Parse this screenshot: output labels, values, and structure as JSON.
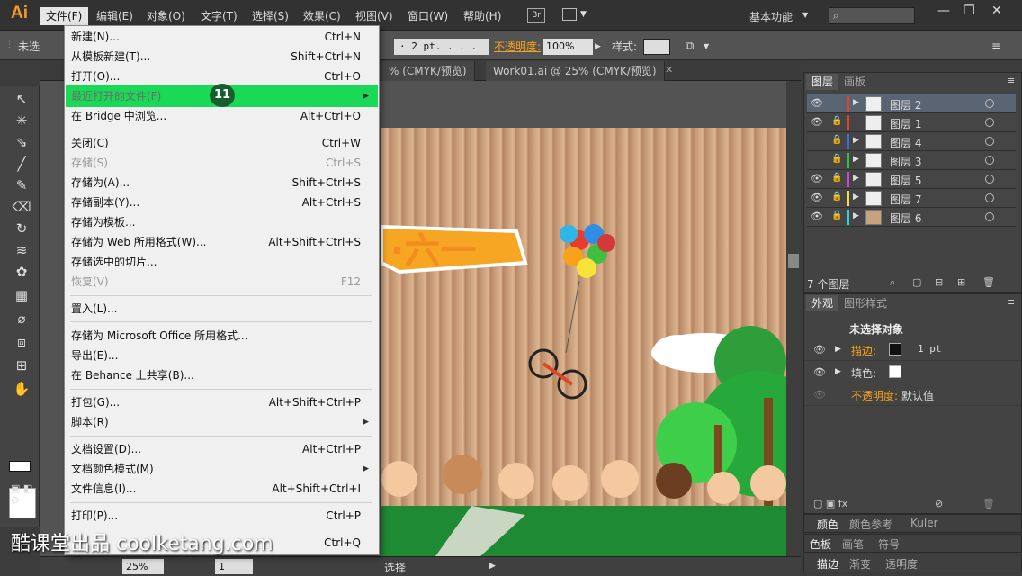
{
  "app": {
    "logo": "Ai",
    "workspace": "基本功能",
    "bridge_badge": "Br"
  },
  "menubar": {
    "items": [
      "文件(F)",
      "编辑(E)",
      "对象(O)",
      "文字(T)",
      "选择(S)",
      "效果(C)",
      "视图(V)",
      "窗口(W)",
      "帮助(H)"
    ],
    "active_index": 0
  },
  "controlbar": {
    "no_selection": "未选",
    "stroke_value": "· 2 pt. . . .",
    "opacity_label": "不透明度:",
    "opacity_value": "100%",
    "style_label": "样式:"
  },
  "tabs": [
    {
      "label": "% (CMYK/预览)",
      "active": false
    },
    {
      "label": "Work01.ai @ 25% (CMYK/预览)",
      "active": false
    }
  ],
  "file_menu": {
    "items": [
      {
        "label": "新建(N)...",
        "shortcut": "Ctrl+N",
        "disabled": false
      },
      {
        "label": "从模板新建(T)...",
        "shortcut": "Shift+Ctrl+N",
        "disabled": false
      },
      {
        "label": "打开(O)...",
        "shortcut": "Ctrl+O",
        "disabled": false
      },
      {
        "label": "最近打开的文件(F)",
        "shortcut": "",
        "disabled": false,
        "submenu": true,
        "highlight": true
      },
      {
        "label": "在 Bridge 中浏览...",
        "shortcut": "Alt+Ctrl+O",
        "disabled": false
      },
      {
        "label": "关闭(C)",
        "shortcut": "Ctrl+W",
        "disabled": false
      },
      {
        "label": "存储(S)",
        "shortcut": "Ctrl+S",
        "disabled": true
      },
      {
        "label": "存储为(A)...",
        "shortcut": "Shift+Ctrl+S",
        "disabled": false
      },
      {
        "label": "存储副本(Y)...",
        "shortcut": "Alt+Ctrl+S",
        "disabled": false
      },
      {
        "label": "存储为模板...",
        "shortcut": "",
        "disabled": false
      },
      {
        "label": "存储为 Web 所用格式(W)...",
        "shortcut": "Alt+Shift+Ctrl+S",
        "disabled": false
      },
      {
        "label": "存储选中的切片...",
        "shortcut": "",
        "disabled": false
      },
      {
        "label": "恢复(V)",
        "shortcut": "F12",
        "disabled": true
      },
      {
        "label": "置入(L)...",
        "shortcut": "",
        "disabled": false
      },
      {
        "label": "存储为 Microsoft Office 所用格式...",
        "shortcut": "",
        "disabled": false
      },
      {
        "label": "导出(E)...",
        "shortcut": "",
        "disabled": false
      },
      {
        "label": "在 Behance 上共享(B)...",
        "shortcut": "",
        "disabled": false
      },
      {
        "label": "打包(G)...",
        "shortcut": "Alt+Shift+Ctrl+P",
        "disabled": false
      },
      {
        "label": "脚本(R)",
        "shortcut": "",
        "disabled": false,
        "submenu": true
      },
      {
        "label": "文档设置(D)...",
        "shortcut": "Alt+Ctrl+P",
        "disabled": false
      },
      {
        "label": "文档颜色模式(M)",
        "shortcut": "",
        "disabled": false,
        "submenu": true
      },
      {
        "label": "文件信息(I)...",
        "shortcut": "Alt+Shift+Ctrl+I",
        "disabled": false
      },
      {
        "label": "打印(P)...",
        "shortcut": "Ctrl+P",
        "disabled": false
      },
      {
        "label": "",
        "shortcut": "Ctrl+Q",
        "disabled": false
      }
    ],
    "step_badge": "11"
  },
  "layers_panel": {
    "tabs": [
      "图层",
      "画板"
    ],
    "layers": [
      {
        "name": "图层 2",
        "visible": true,
        "locked": false,
        "color": "#e0452a",
        "selected": true
      },
      {
        "name": "图层 1",
        "visible": true,
        "locked": true,
        "color": "#e0452a",
        "selected": false
      },
      {
        "name": "图层 4",
        "visible": false,
        "locked": true,
        "color": "#3a6fd8",
        "selected": false
      },
      {
        "name": "图层 3",
        "visible": false,
        "locked": true,
        "color": "#2fc43d",
        "selected": false
      },
      {
        "name": "图层 5",
        "visible": true,
        "locked": true,
        "color": "#c54ad6",
        "selected": false
      },
      {
        "name": "图层 7",
        "visible": true,
        "locked": true,
        "color": "#f2e03a",
        "selected": false
      },
      {
        "name": "图层 6",
        "visible": true,
        "locked": true,
        "color": "#2ad6d6",
        "selected": false
      }
    ],
    "count_label": "7 个图层"
  },
  "appearance_panel": {
    "tabs": [
      "外观",
      "图形样式"
    ],
    "title": "未选择对象",
    "stroke_label": "描边:",
    "stroke_value": "1 pt",
    "fill_label": "填色:",
    "opacity_label": "不透明度:",
    "opacity_value": "默认值"
  },
  "collapsed_panels": [
    [
      "颜色",
      "颜色参考",
      "Kuler"
    ],
    [
      "色板",
      "画笔",
      "符号"
    ],
    [
      "描边",
      "渐变",
      "透明度"
    ]
  ],
  "statusbar": {
    "zoom": "25%",
    "page": "1",
    "status": "选择"
  },
  "watermark": "酷课堂出品 coolketang.com",
  "colors": {
    "highlight": "#19d957",
    "accent_orange": "#f7a21b",
    "badge": "#165e2e"
  }
}
